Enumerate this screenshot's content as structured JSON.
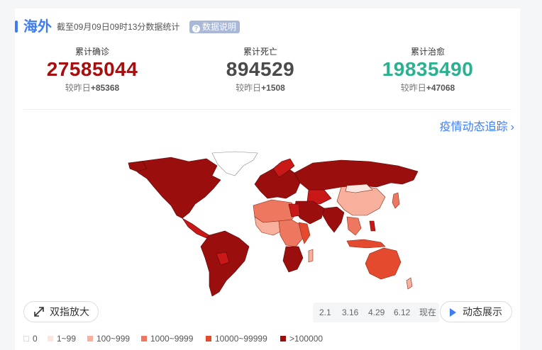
{
  "header": {
    "title": "海外",
    "subtitle": "截至09月09日09时13分数据统计",
    "explain_label": "数据说明"
  },
  "stats": {
    "confirmed": {
      "label": "累计确诊",
      "value": "27585044",
      "delta_prefix": "较昨日",
      "delta": "+85368"
    },
    "deaths": {
      "label": "累计死亡",
      "value": "894529",
      "delta_prefix": "较昨日",
      "delta": "+1508"
    },
    "recovered": {
      "label": "累计治愈",
      "value": "19835490",
      "delta_prefix": "较昨日",
      "delta": "+47068"
    }
  },
  "track_link": "疫情动态追踪",
  "zoom_button": "双指放大",
  "timeline": [
    "2.1",
    "3.16",
    "4.29",
    "6.12",
    "现在"
  ],
  "play_button": "动态展示",
  "legend": [
    {
      "label": "0",
      "color": "#ffffff"
    },
    {
      "label": "1~99",
      "color": "#fbe7e2"
    },
    {
      "label": "100~999",
      "color": "#f7b09b"
    },
    {
      "label": "1000~9999",
      "color": "#ee7760"
    },
    {
      "label": "10000~99999",
      "color": "#e34a2e"
    },
    {
      "label": ">100000",
      "color": "#9b0e0e"
    }
  ],
  "colors": {
    "accent": "#3d7cf5",
    "confirmed": "#a50f0f",
    "deaths": "#4a4a4a",
    "recovered": "#2ab190"
  }
}
